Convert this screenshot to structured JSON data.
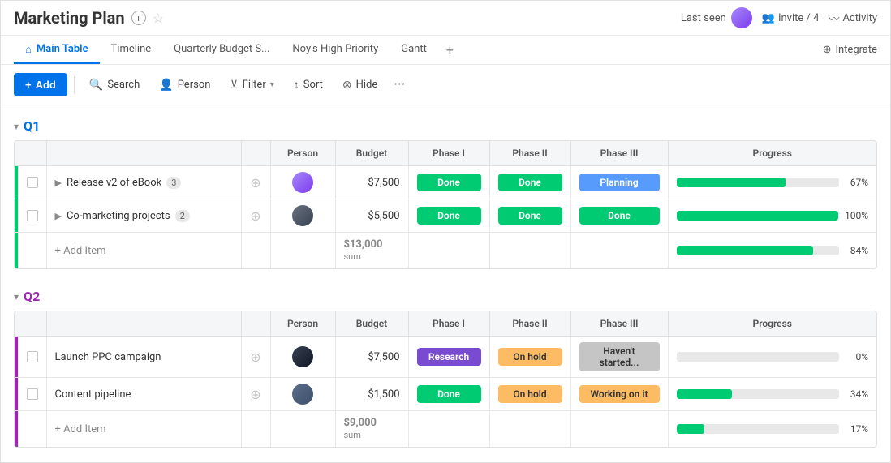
{
  "header": {
    "title": "Marketing Plan",
    "last_seen_label": "Last seen",
    "invite_label": "Invite / 4",
    "activity_label": "Activity"
  },
  "tabs": {
    "items": [
      {
        "id": "main-table",
        "label": "Main Table",
        "active": true
      },
      {
        "id": "timeline",
        "label": "Timeline",
        "active": false
      },
      {
        "id": "quarterly",
        "label": "Quarterly Budget S...",
        "active": false
      },
      {
        "id": "high-priority",
        "label": "Noy's High Priority",
        "active": false
      },
      {
        "id": "gantt",
        "label": "Gantt",
        "active": false
      }
    ],
    "add_label": "+",
    "integrate_label": "Integrate"
  },
  "toolbar": {
    "add_label": "+ Add",
    "search_label": "Search",
    "person_label": "Person",
    "filter_label": "Filter",
    "sort_label": "Sort",
    "hide_label": "Hide",
    "more_label": "···"
  },
  "groups": [
    {
      "id": "q1",
      "title": "Q1",
      "color_class": "q1",
      "columns": {
        "person": "Person",
        "budget": "Budget",
        "phase1": "Phase I",
        "phase2": "Phase II",
        "phase3": "Phase III",
        "progress": "Progress"
      },
      "rows": [
        {
          "id": "row-1",
          "name": "Release v2 of eBook",
          "count": 3,
          "person_class": "av1",
          "budget": "$7,500",
          "phase1": {
            "label": "Done",
            "class": "badge-done"
          },
          "phase2": {
            "label": "Done",
            "class": "badge-done"
          },
          "phase3": {
            "label": "Planning",
            "class": "badge-planning"
          },
          "progress": 67
        },
        {
          "id": "row-2",
          "name": "Co-marketing projects",
          "count": 2,
          "person_class": "av2",
          "budget": "$5,500",
          "phase1": {
            "label": "Done",
            "class": "badge-done"
          },
          "phase2": {
            "label": "Done",
            "class": "badge-done"
          },
          "phase3": {
            "label": "Done",
            "class": "badge-done"
          },
          "progress": 100
        }
      ],
      "footer": {
        "add_item_label": "+ Add Item",
        "budget_total": "$13,000",
        "budget_sum_label": "sum",
        "progress": 84
      }
    },
    {
      "id": "q2",
      "title": "Q2",
      "color_class": "q2",
      "columns": {
        "person": "Person",
        "budget": "Budget",
        "phase1": "Phase I",
        "phase2": "Phase II",
        "phase3": "Phase III",
        "progress": "Progress"
      },
      "rows": [
        {
          "id": "row-3",
          "name": "Launch PPC campaign",
          "count": null,
          "person_class": "av3",
          "budget": "$7,500",
          "phase1": {
            "label": "Research",
            "class": "badge-research"
          },
          "phase2": {
            "label": "On hold",
            "class": "badge-onhold"
          },
          "phase3": {
            "label": "Haven't started...",
            "class": "badge-haventstarted"
          },
          "progress": 0
        },
        {
          "id": "row-4",
          "name": "Content pipeline",
          "count": null,
          "person_class": "av4",
          "budget": "$1,500",
          "phase1": {
            "label": "Done",
            "class": "badge-done"
          },
          "phase2": {
            "label": "On hold",
            "class": "badge-onhold"
          },
          "phase3": {
            "label": "Working on it",
            "class": "badge-workinonit"
          },
          "progress": 34
        }
      ],
      "footer": {
        "add_item_label": "+ Add Item",
        "budget_total": "$9,000",
        "budget_sum_label": "sum",
        "progress": 17
      }
    }
  ]
}
